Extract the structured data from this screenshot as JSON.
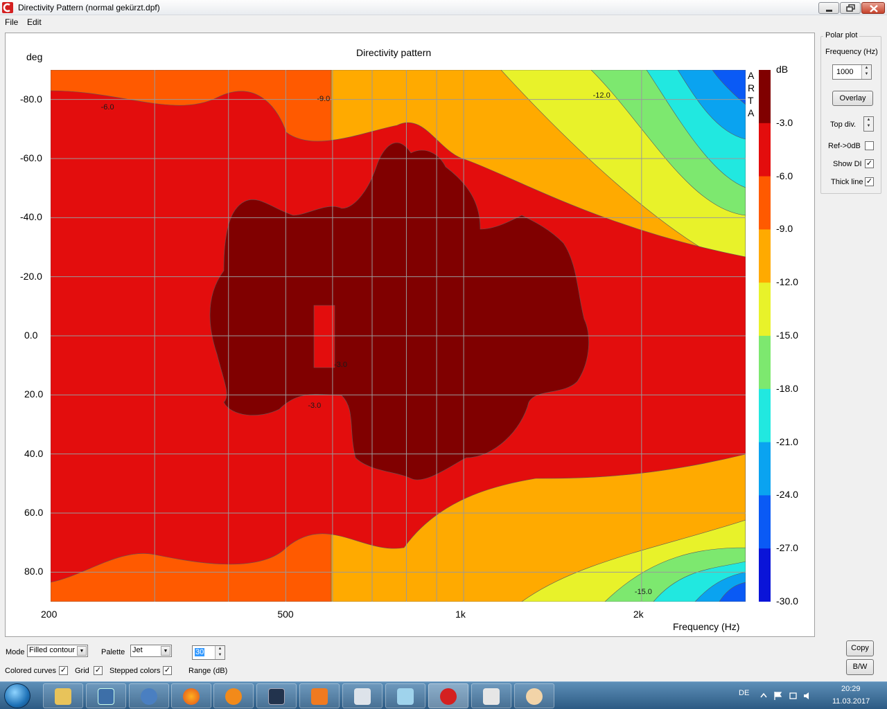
{
  "window": {
    "title": "Directivity Pattern  (normal gekürzt.dpf)"
  },
  "menu": {
    "file": "File",
    "edit": "Edit"
  },
  "plot": {
    "title": "Directivity pattern",
    "y_unit": "deg",
    "x_label": "Frequency (Hz)",
    "colorbar_unit": "dB",
    "watermark": [
      "A",
      "R",
      "T",
      "A"
    ],
    "y_ticks": [
      "-80.0",
      "-60.0",
      "-40.0",
      "-20.0",
      "0.0",
      "20.0",
      "40.0",
      "60.0",
      "80.0"
    ],
    "x_ticks": [
      "200",
      "500",
      "1k",
      "2k"
    ],
    "colorbar_ticks": [
      "-3.0",
      "-6.0",
      "-9.0",
      "-12.0",
      "-15.0",
      "-18.0",
      "-21.0",
      "-24.0",
      "-27.0",
      "-30.0"
    ],
    "contour_labels": [
      "-6.0",
      "-9.0",
      "-12.0",
      "-3.0",
      "-3.0",
      "-15.0"
    ],
    "palette_colors": [
      "#800000",
      "#e30d0d",
      "#ff5a00",
      "#ffaa00",
      "#e8f22a",
      "#7de86f",
      "#21e8e0",
      "#0aa3f0",
      "#0a5af5",
      "#0a14d8"
    ]
  },
  "chart_data": {
    "type": "heatmap",
    "title": "Directivity pattern",
    "xlabel": "Frequency (Hz)",
    "ylabel": "deg",
    "x_scale": "log",
    "xlim": [
      200,
      3000
    ],
    "ylim": [
      -90,
      90
    ],
    "color_scale": {
      "unit": "dB",
      "min": -30,
      "max": 0,
      "step": 3
    },
    "x_ticks": [
      200,
      500,
      1000,
      2000
    ],
    "y_ticks": [
      -80,
      -60,
      -40,
      -20,
      0,
      20,
      40,
      60,
      80
    ],
    "grid": true,
    "legend": "colorbar-right"
  },
  "polar_plot": {
    "group_label": "Polar plot",
    "frequency_label": "Frequency (Hz)",
    "frequency_value": "1000",
    "overlay_button": "Overlay",
    "top_div_label": "Top div.",
    "ref_0db_label": "Ref->0dB",
    "show_di_label": "Show DI",
    "thick_line_label": "Thick line",
    "ref_0db_checked": false,
    "show_di_checked": true,
    "thick_line_checked": true
  },
  "controls": {
    "mode_label": "Mode",
    "mode_value": "Filled contour",
    "palette_label": "Palette",
    "palette_value": "Jet",
    "range_value": "30",
    "range_label": "Range (dB)",
    "colored_curves_label": "Colored curves",
    "grid_label": "Grid",
    "stepped_colors_label": "Stepped colors",
    "copy_button": "Copy",
    "bw_button": "B/W"
  },
  "taskbar": {
    "language": "DE",
    "time": "20:29",
    "date": "11.03.2017"
  }
}
